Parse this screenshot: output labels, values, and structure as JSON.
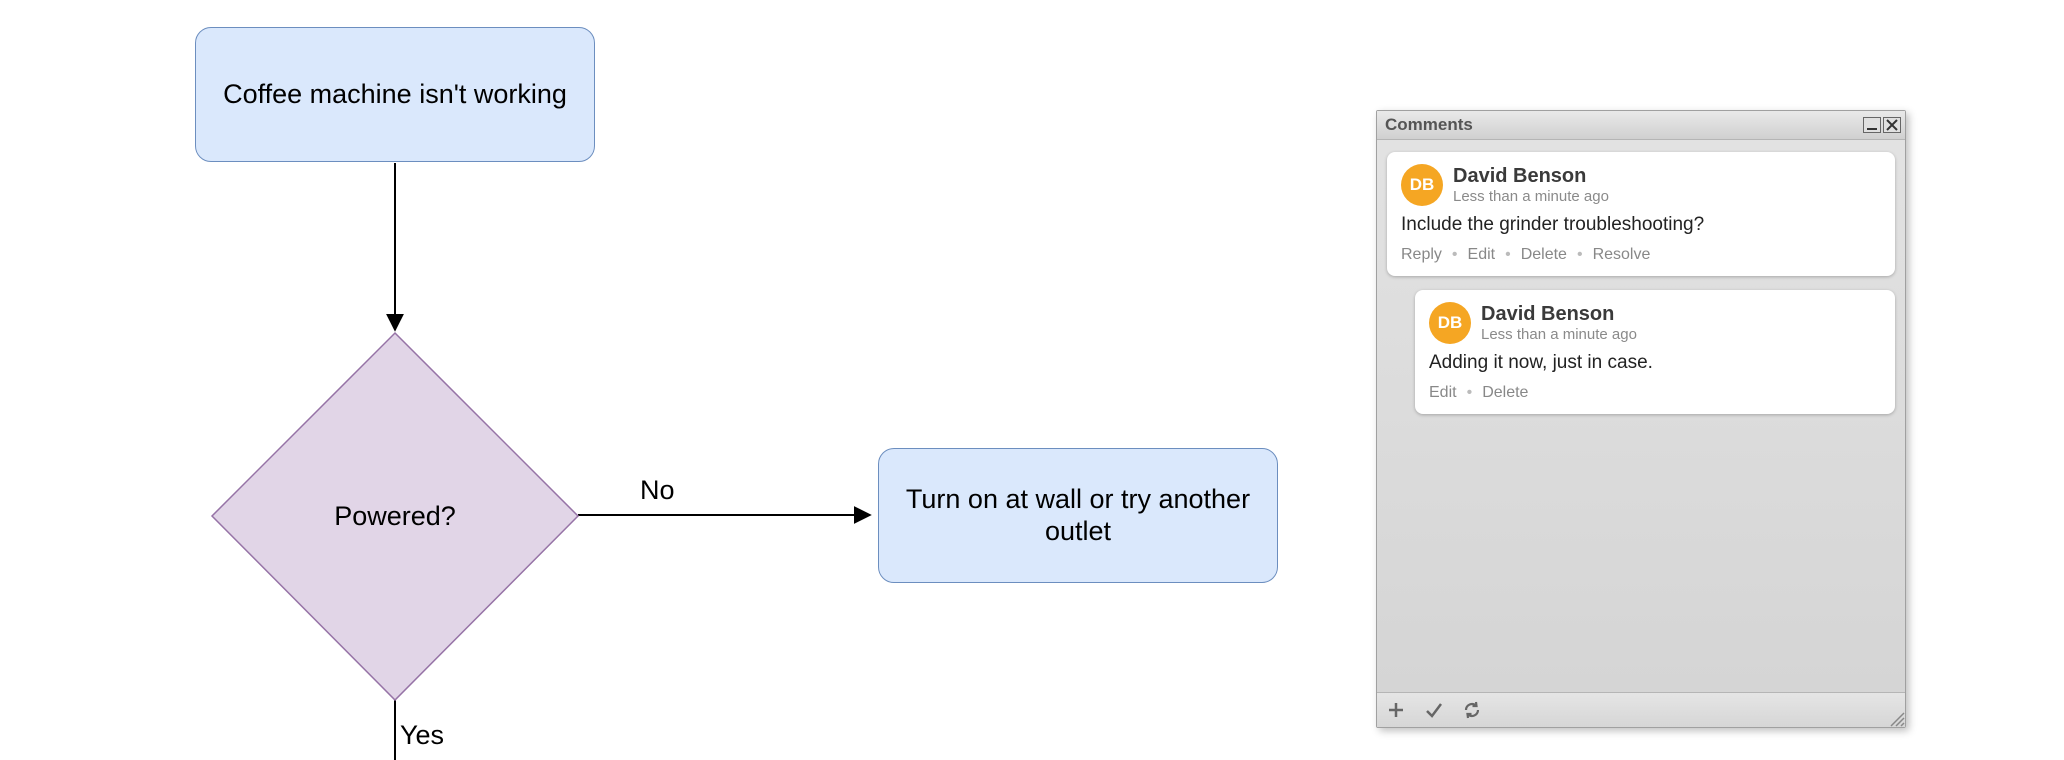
{
  "flowchart": {
    "start": "Coffee machine isn't working",
    "decision": "Powered?",
    "edge_no": "No",
    "edge_yes": "Yes",
    "action_no": "Turn on at wall or try another outlet"
  },
  "panel": {
    "title": "Comments",
    "comments": [
      {
        "initials": "DB",
        "author": "David Benson",
        "time": "Less than a minute ago",
        "text": "Include the grinder troubleshooting?",
        "actions": {
          "reply": "Reply",
          "edit": "Edit",
          "delete": "Delete",
          "resolve": "Resolve"
        }
      },
      {
        "initials": "DB",
        "author": "David Benson",
        "time": "Less than a minute ago",
        "text": "Adding it now, just in case.",
        "actions": {
          "edit": "Edit",
          "delete": "Delete"
        }
      }
    ]
  }
}
